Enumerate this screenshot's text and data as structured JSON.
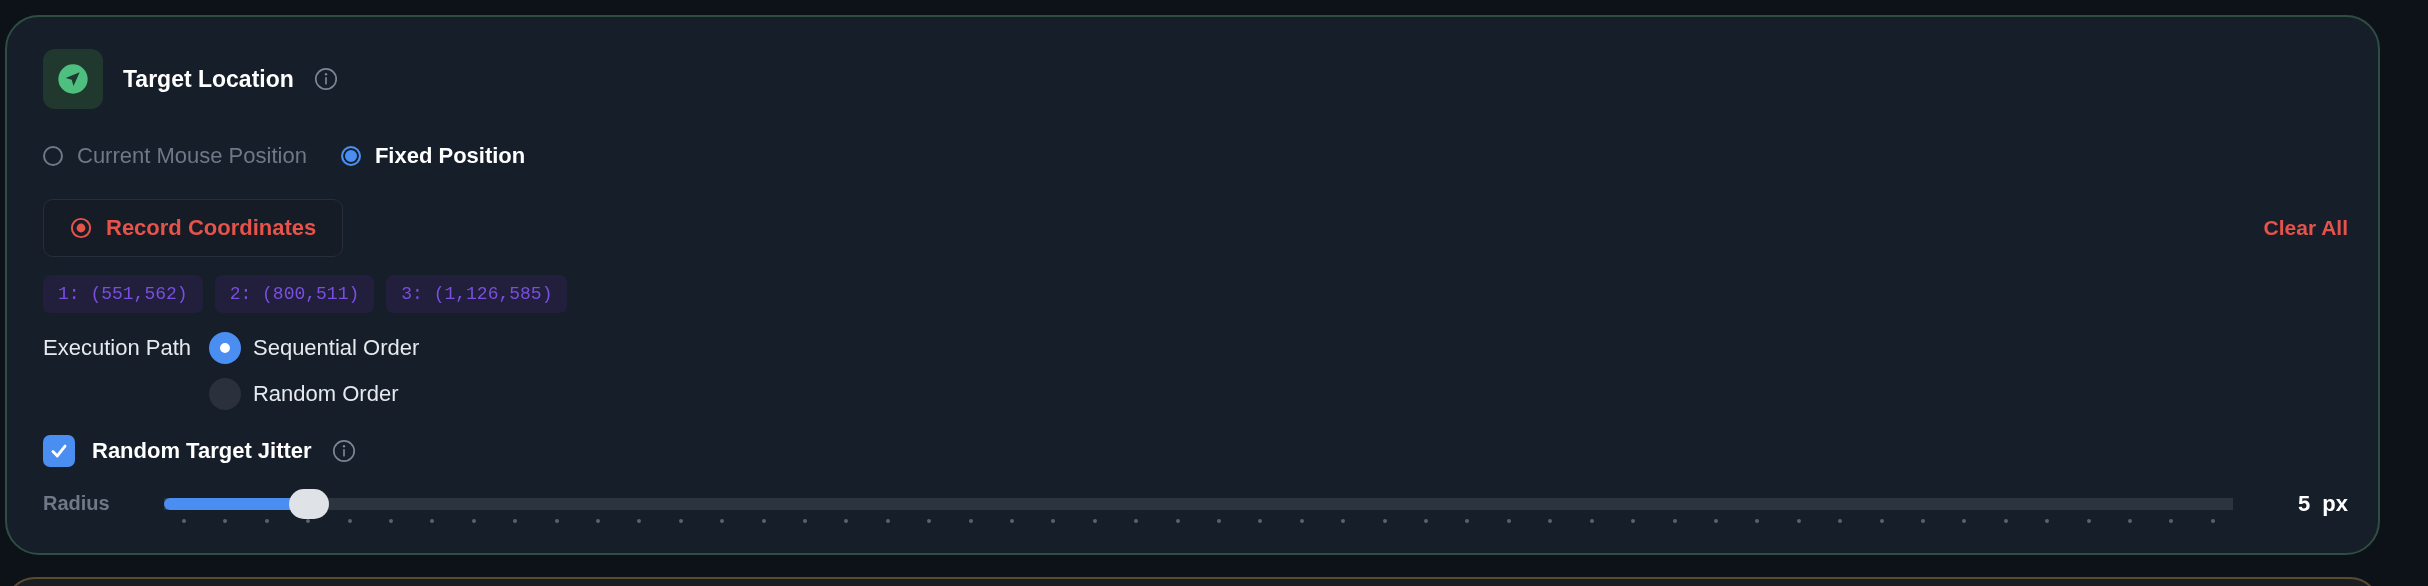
{
  "header": {
    "title": "Target Location"
  },
  "target_modes": [
    {
      "label": "Current Mouse Position",
      "selected": false
    },
    {
      "label": "Fixed Position",
      "selected": true
    }
  ],
  "record_button": {
    "label": "Record Coordinates"
  },
  "clear_link": {
    "label": "Clear All"
  },
  "coordinates": [
    {
      "label": "1: (551,562)"
    },
    {
      "label": "2: (800,511)"
    },
    {
      "label": "3: (1,126,585)"
    }
  ],
  "execution_path": {
    "label": "Execution Path",
    "options": [
      {
        "label": "Sequential Order",
        "selected": true
      },
      {
        "label": "Random Order",
        "selected": false
      }
    ]
  },
  "jitter": {
    "label": "Random Target Jitter",
    "checked": true
  },
  "radius": {
    "label": "Radius",
    "level": 0.07,
    "value": "5",
    "unit": "px"
  }
}
